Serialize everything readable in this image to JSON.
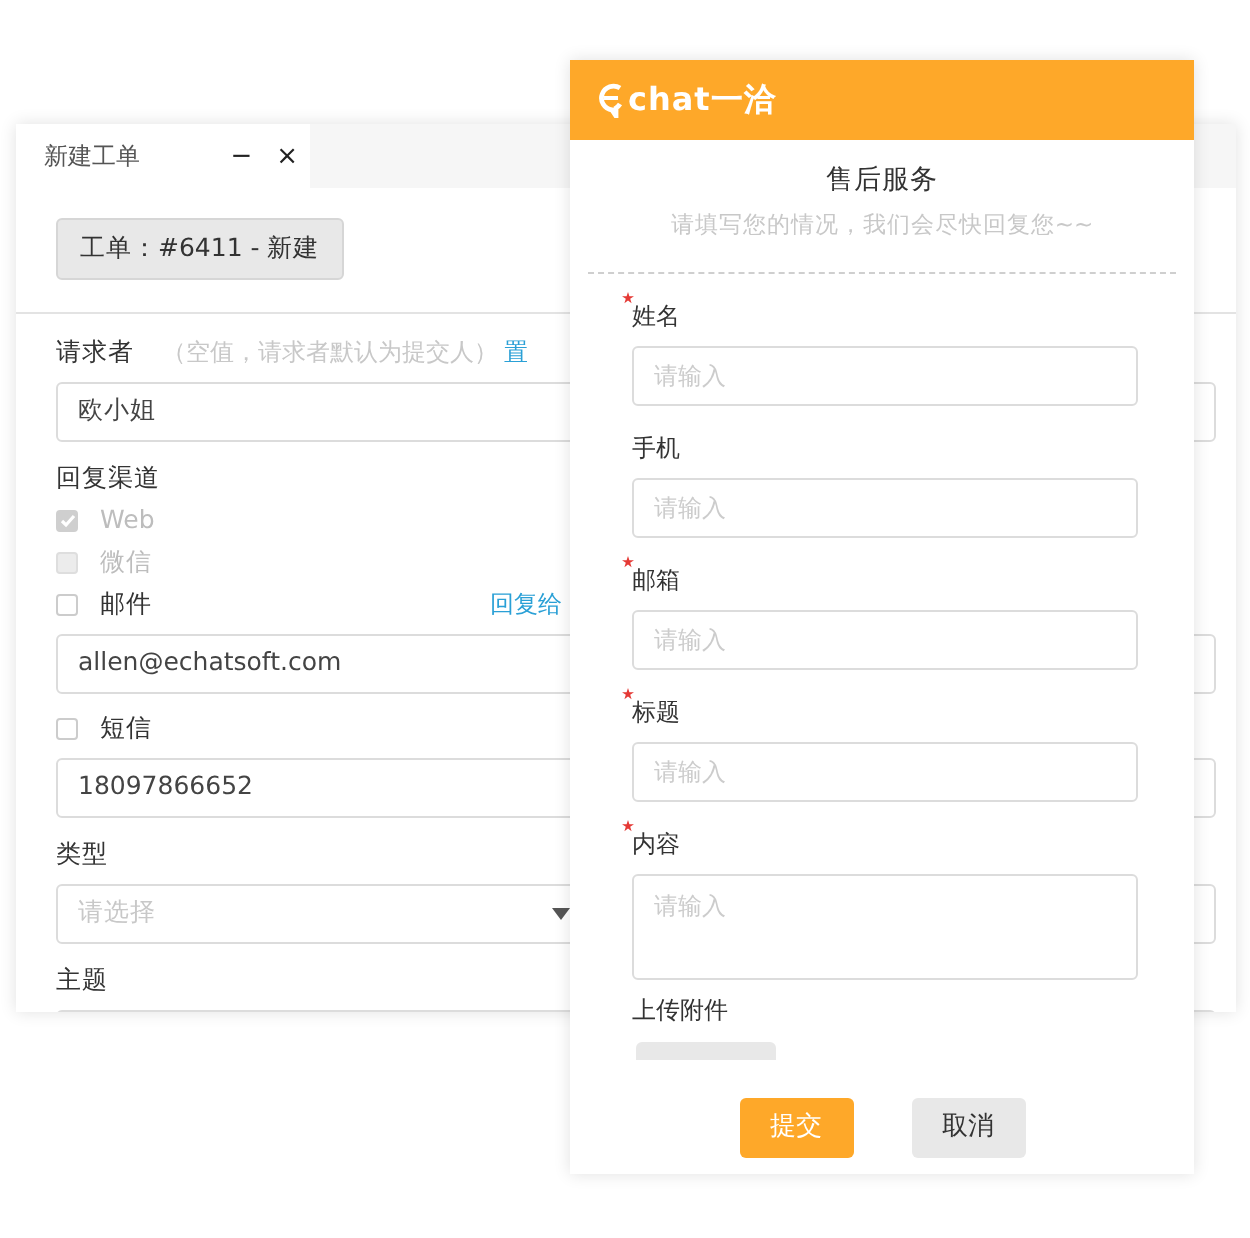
{
  "ticket_window": {
    "title": "新建工单",
    "minimize": "−",
    "close": "×",
    "ticket_button": "工单：#6411 - 新建",
    "rows": [
      {
        "kind": "label",
        "text": "请求者",
        "hint": "（空值，请求者默认为提交人）",
        "link": "置"
      },
      {
        "kind": "input",
        "value": "欧小姐"
      },
      {
        "kind": "label",
        "text": "回复渠道"
      },
      {
        "kind": "checkbox",
        "label": "Web",
        "checked": true,
        "disabled": true
      },
      {
        "kind": "checkbox",
        "label": "微信",
        "checked": false,
        "disabled": true
      },
      {
        "kind": "checkbox",
        "label": "邮件",
        "checked": false,
        "disabled": false,
        "link": "回复给"
      },
      {
        "kind": "input",
        "value": "allen@echatsoft.com"
      },
      {
        "kind": "checkbox",
        "label": "短信",
        "checked": false,
        "disabled": false
      },
      {
        "kind": "input",
        "value": "18097866652"
      },
      {
        "kind": "label",
        "text": "类型"
      },
      {
        "kind": "select",
        "placeholder": "请选择"
      },
      {
        "kind": "label",
        "text": "主题"
      },
      {
        "kind": "input"
      }
    ]
  },
  "service_panel": {
    "logo": "chat一洽",
    "title": "售后服务",
    "subtitle": "请填写您的情况，我们会尽快回复您~~",
    "fields": [
      {
        "kind": "input",
        "label": "姓名",
        "required": true,
        "placeholder": "请输入"
      },
      {
        "kind": "input",
        "label": "手机",
        "required": false,
        "placeholder": "请输入"
      },
      {
        "kind": "input",
        "label": "邮箱",
        "required": true,
        "placeholder": "请输入"
      },
      {
        "kind": "input",
        "label": "标题",
        "required": true,
        "placeholder": "请输入"
      },
      {
        "kind": "textarea",
        "label": "内容",
        "required": true,
        "placeholder": "请输入"
      },
      {
        "kind": "upload",
        "label": "上传附件"
      }
    ],
    "buttons": [
      {
        "kind": "primary",
        "label": "提交"
      },
      {
        "kind": "secondary",
        "label": "取消"
      }
    ]
  }
}
